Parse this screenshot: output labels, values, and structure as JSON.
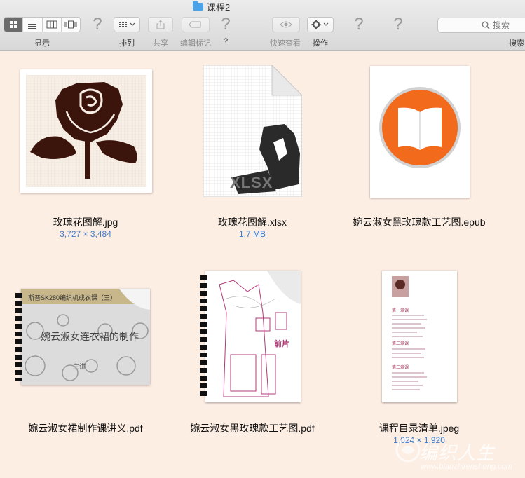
{
  "window": {
    "title": "课程2"
  },
  "toolbar": {
    "view_label": "显示",
    "arrange_label": "排列",
    "share_label": "共享",
    "tags_label": "编辑标记",
    "help_label": "?",
    "quicklook_label": "快速查看",
    "action_label": "操作",
    "search_label": "搜索",
    "search_placeholder": "搜索",
    "help_glyph": "?"
  },
  "files": [
    {
      "name": "玫瑰花图解.jpg",
      "meta": "3,727 × 3,484"
    },
    {
      "name": "玫瑰花图解.xlsx",
      "meta": "1.7 MB",
      "badge": "XLSX"
    },
    {
      "name": "婉云淑女黑玫瑰款工艺图.epub",
      "meta": ""
    },
    {
      "name": "婉云淑女裙制作课讲义.pdf",
      "meta": "",
      "preview_header": "斯普SK280编织机成衣课（三）",
      "preview_title": "婉云淑女连衣裙的制作",
      "preview_sub": "主讲"
    },
    {
      "name": "婉云淑女黑玫瑰款工艺图.pdf",
      "meta": "",
      "preview_label": "前片"
    },
    {
      "name": "课程目录清单.jpeg",
      "meta": "1,024 × 1,920",
      "preview_sections": [
        "第一章课",
        "第二章课",
        "第三章课"
      ]
    }
  ],
  "watermark": {
    "text": "编织人生",
    "url": "www.bianzhirensheng.com"
  },
  "colors": {
    "accent_meta": "#3f7cc9",
    "background": "#fdeee4",
    "rose": "#3b140c",
    "ibooks_orange": "#f26b1d"
  }
}
